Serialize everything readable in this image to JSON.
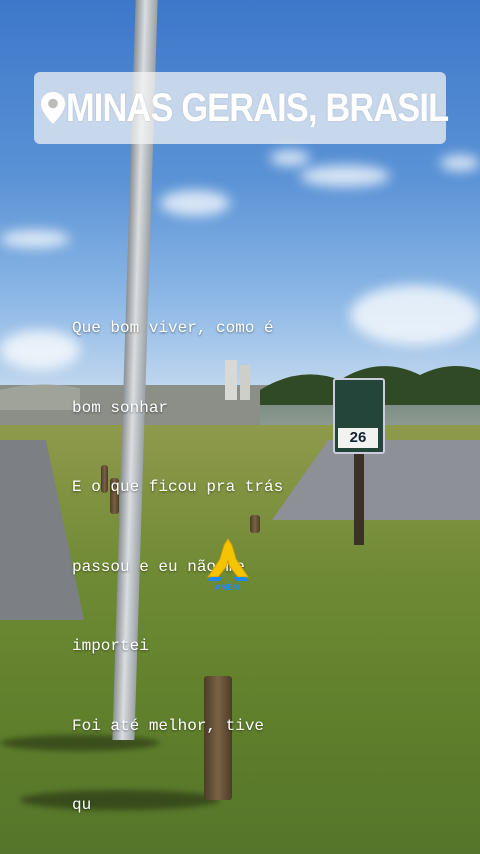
{
  "location": {
    "icon": "map-pin-icon",
    "text": "MINAS GERAIS, BRASIL"
  },
  "caption": {
    "lines": [
      "Que bom viver, como é",
      "bom sonhar",
      "E o que ficou pra trás",
      "passou e eu não me",
      "importei",
      "Foi até melhor, tive",
      "qu"
    ]
  },
  "scene": {
    "sign_number": "26"
  },
  "sticker": {
    "icon": "praying-hands-icon",
    "label": "AMÉM"
  },
  "colors": {
    "sky": "#4a84cf",
    "grass": "#6a8a32",
    "sticker_text": "#ffffff",
    "praying_hands": "#f5c400"
  }
}
